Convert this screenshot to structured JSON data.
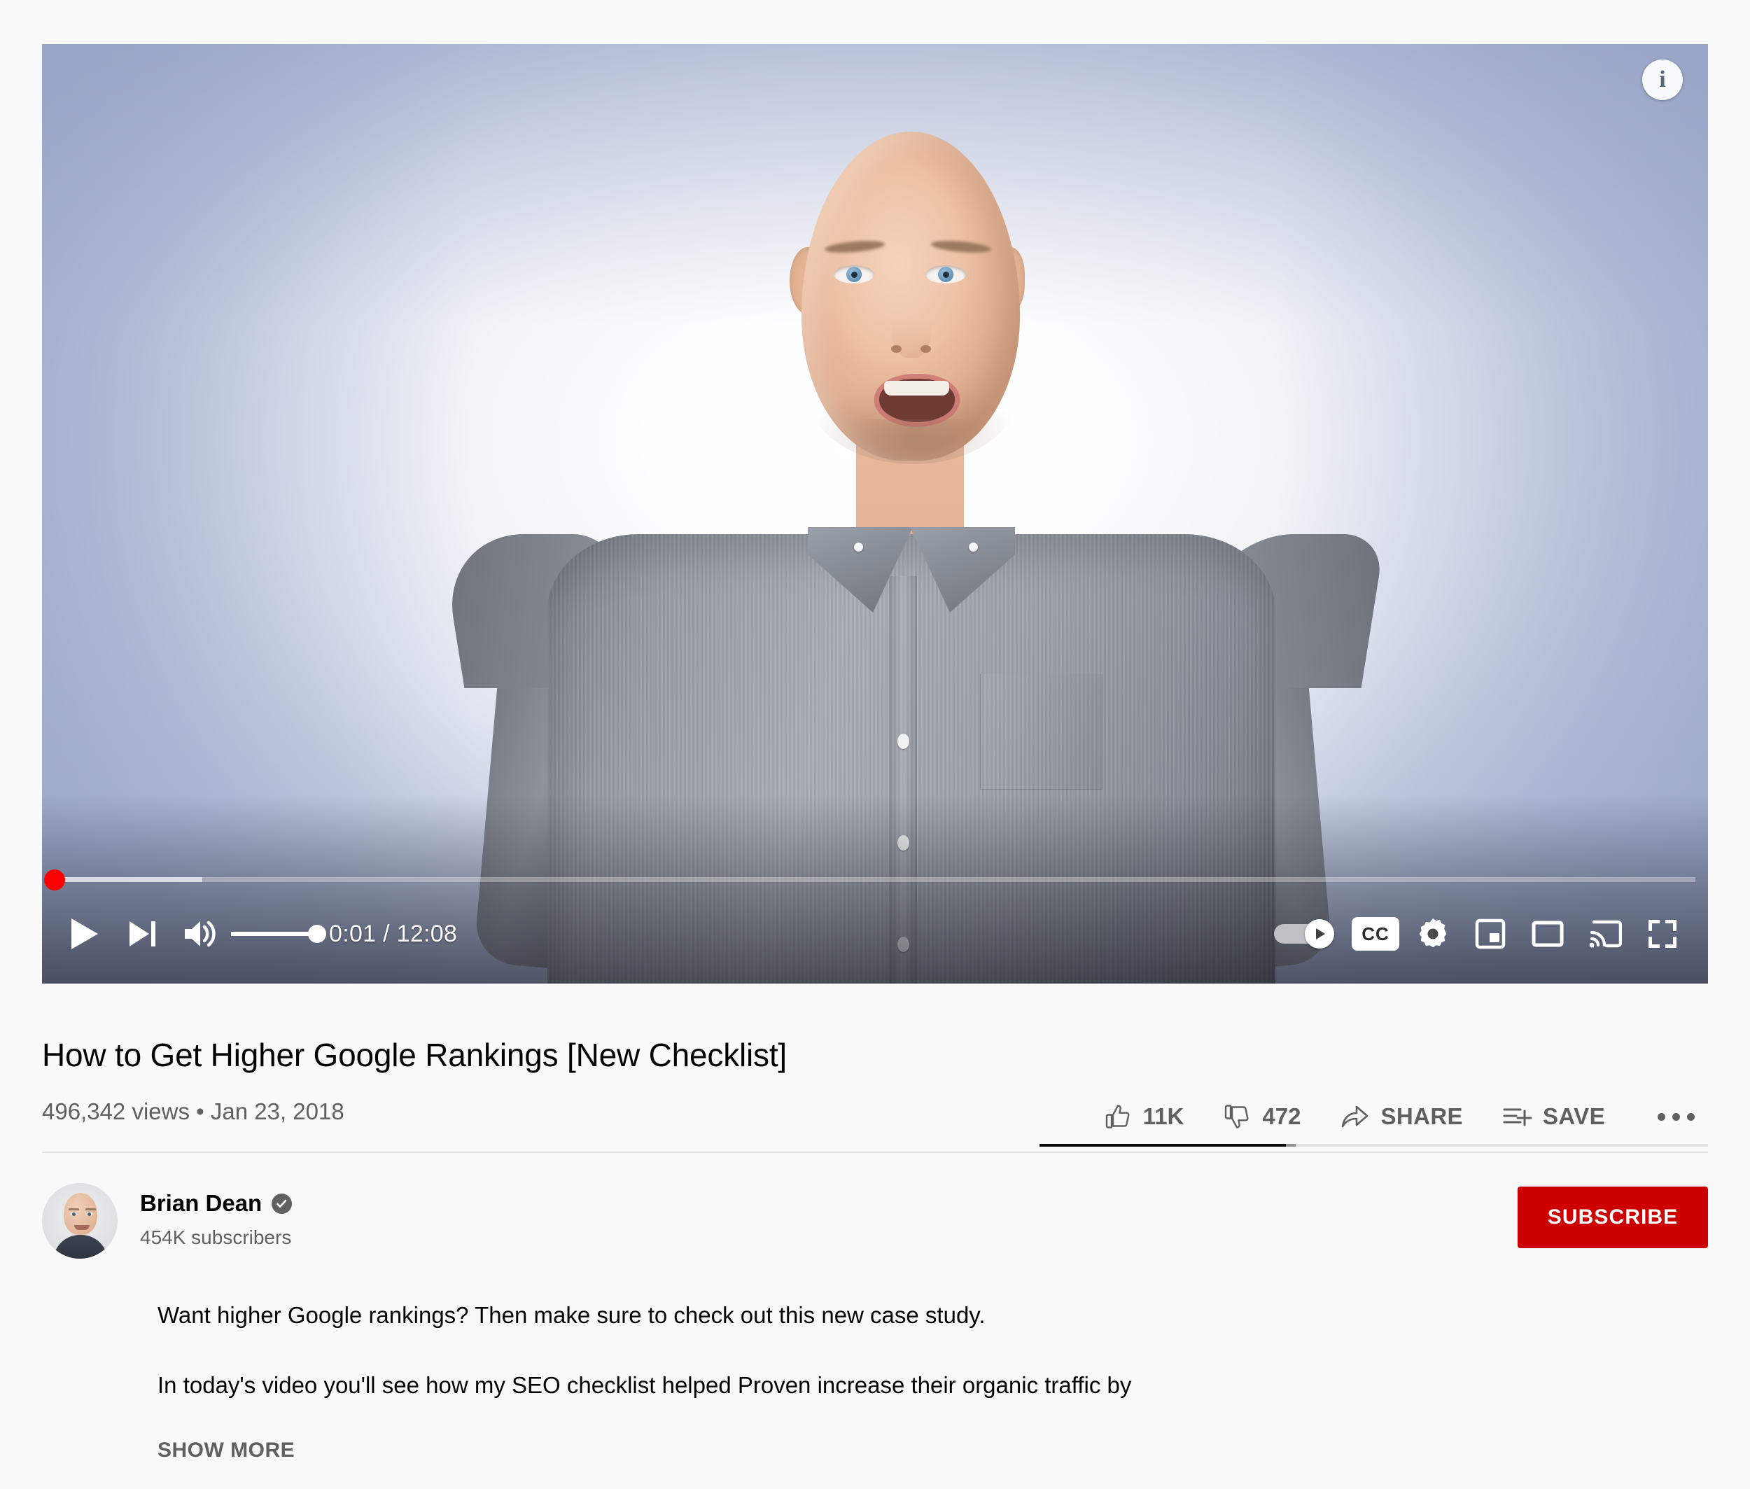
{
  "player": {
    "info_button_glyph": "i",
    "time_display": "0:01 / 12:08",
    "cc_label": "CC",
    "controls": {
      "play": "Play",
      "next": "Next",
      "volume": "Mute",
      "autoplay": "Autoplay",
      "subtitles": "Subtitles/closed captions",
      "settings": "Settings",
      "miniplayer": "Miniplayer",
      "theater": "Theater mode",
      "cast": "Play on TV",
      "fullscreen": "Full screen"
    },
    "progress": {
      "played_percent": 0.2,
      "loaded_percent": 9,
      "elapsed": "0:01",
      "duration": "12:08"
    },
    "volume_percent": 100
  },
  "video": {
    "title": "How to Get Higher Google Rankings [New Checklist]",
    "views": "496,342 views",
    "separator": "•",
    "published": "Jan 23, 2018"
  },
  "actions": {
    "like": {
      "label": "Like",
      "count": "11K"
    },
    "dislike": {
      "label": "Dislike",
      "count": "472"
    },
    "share": {
      "label": "SHARE"
    },
    "save": {
      "label": "SAVE"
    },
    "more": {
      "label": "More actions"
    }
  },
  "ratio": {
    "like_percent": 96
  },
  "channel": {
    "name": "Brian Dean",
    "verified": true,
    "subscribers": "454K subscribers",
    "subscribe_label": "SUBSCRIBE",
    "avatar_alt": "Brian Dean channel avatar"
  },
  "description": {
    "paragraph_1": "Want higher Google rankings? Then make sure to check out this new case study.",
    "paragraph_2": "In today's video you'll see how my SEO checklist helped Proven increase their organic traffic by",
    "show_more": "SHOW MORE"
  },
  "colors": {
    "brand_red": "#cc0000",
    "progress_red": "#ff0000",
    "page_background": "#f9f9f9",
    "primary_text": "#030303",
    "secondary_text": "#606060"
  }
}
